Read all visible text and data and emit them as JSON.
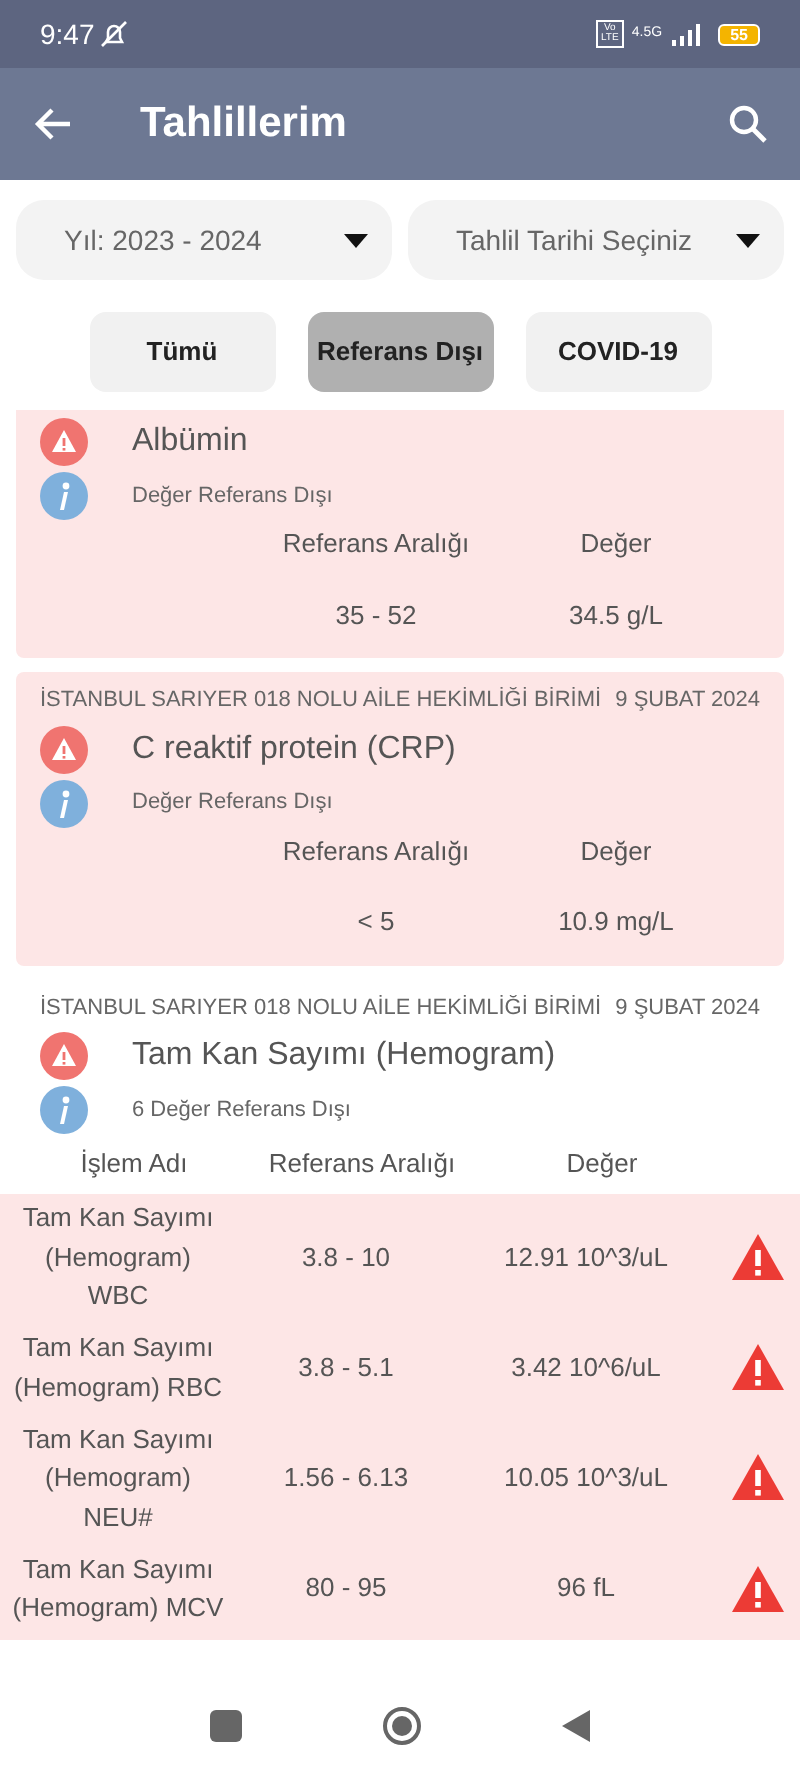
{
  "status_bar": {
    "time": "9:47",
    "volte": "Vo LTE",
    "network": "4.5G",
    "battery": "55"
  },
  "app_bar": {
    "title": "Tahlillerim"
  },
  "dropdowns": [
    {
      "value": "Yıl: 2023 - 2024"
    },
    {
      "value": "Tahlil Tarihi Seçiniz"
    }
  ],
  "filters": [
    {
      "label": "Tümü",
      "selected": false
    },
    {
      "label": "Referans Dışı",
      "selected": true
    },
    {
      "label": "COVID-19",
      "selected": false
    }
  ],
  "results": [
    {
      "kind": "single",
      "title": "Albümin",
      "note": "Değer Referans Dışı",
      "range_label": "Referans Aralığı",
      "value_label": "Değer",
      "range": "35 - 52",
      "value": "34.5 g/L"
    },
    {
      "kind": "single",
      "facility": "İSTANBUL SARIYER 018 NOLU AİLE HEKİMLİĞİ BİRİMİ",
      "date": "9 ŞUBAT 2024",
      "title": "C reaktif protein (CRP)",
      "note": "Değer Referans Dışı",
      "range_label": "Referans Aralığı",
      "value_label": "Değer",
      "range": "< 5",
      "value": "10.9 mg/L"
    },
    {
      "kind": "group",
      "facility": "İSTANBUL SARIYER 018 NOLU AİLE HEKİMLİĞİ BİRİMİ",
      "date": "9 ŞUBAT 2024",
      "title": "Tam Kan Sayımı (Hemogram)",
      "note": "6 Değer Referans Dışı",
      "name_label": "İşlem Adı",
      "range_label": "Referans Aralığı",
      "value_label": "Değer",
      "rows": [
        {
          "name": "Tam Kan Sayımı (Hemogram) WBC",
          "range": "3.8 - 10",
          "value": "12.91 10^3/uL"
        },
        {
          "name": "Tam Kan Sayımı (Hemogram) RBC",
          "range": "3.8 - 5.1",
          "value": "3.42 10^6/uL"
        },
        {
          "name": "Tam Kan Sayımı (Hemogram) NEU#",
          "range": "1.56 - 6.13",
          "value": "10.05 10^3/uL"
        },
        {
          "name": "Tam Kan Sayımı (Hemogram) MCV",
          "range": "80 - 95",
          "value": "96 fL"
        }
      ]
    }
  ]
}
